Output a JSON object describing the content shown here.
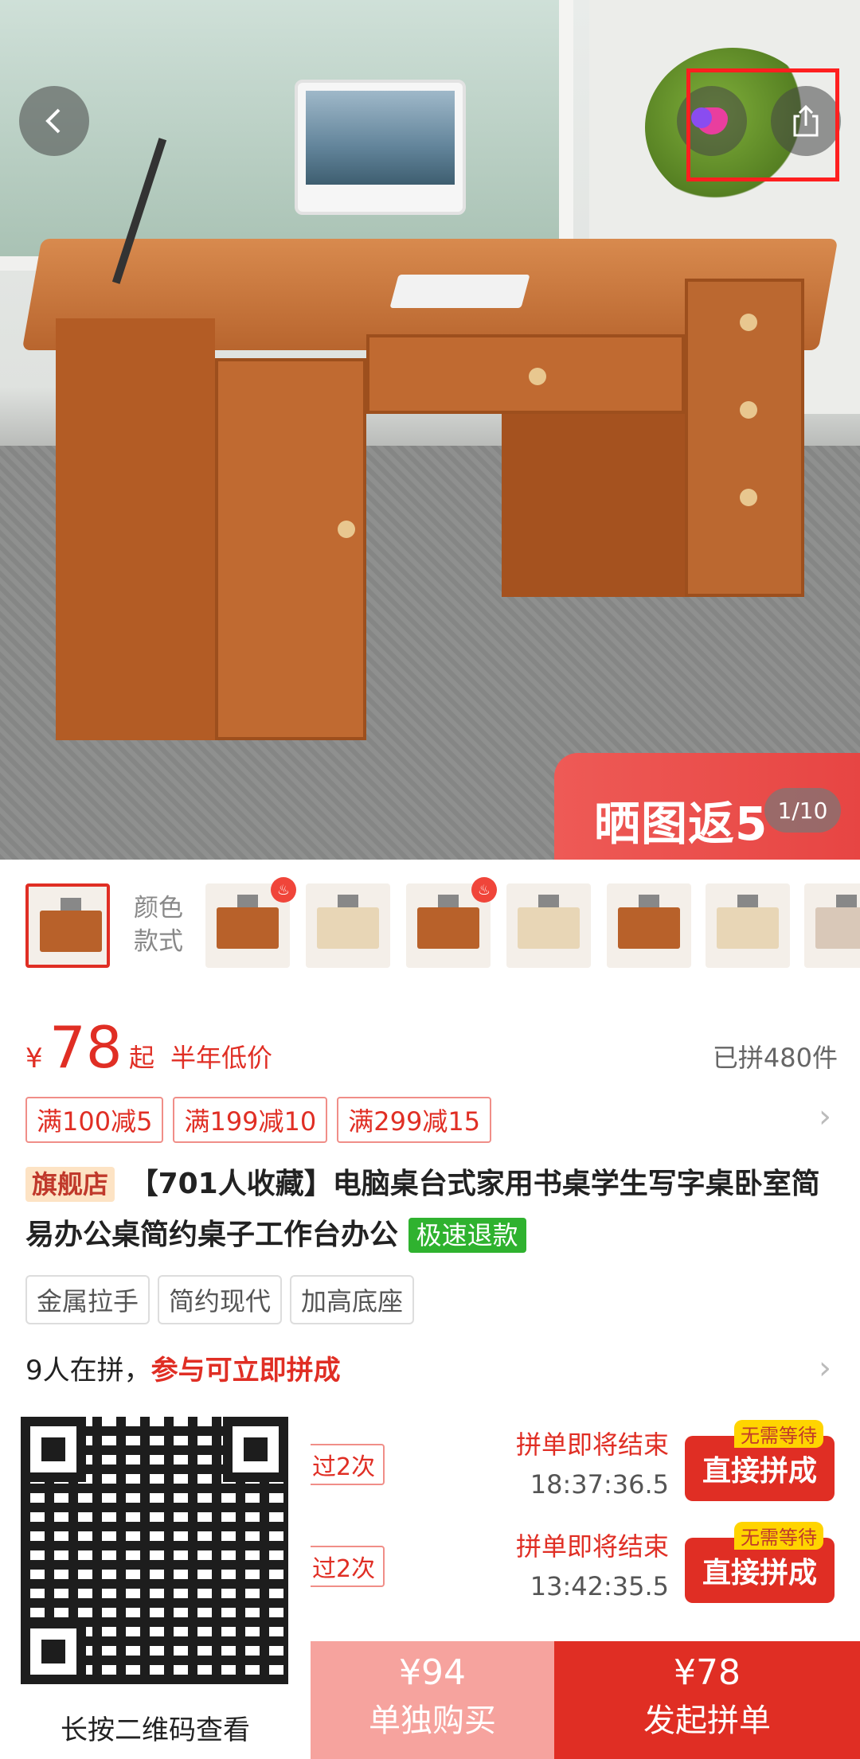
{
  "hero": {
    "promo_text": "晒图返5",
    "image_counter": "1/10"
  },
  "thumbs": {
    "label_line1": "颜色",
    "label_line2": "款式"
  },
  "price": {
    "currency": "¥",
    "value": "78",
    "suffix": "起",
    "low_label": "半年低价",
    "sold": "已拼480件"
  },
  "coupons": [
    "满100减5",
    "满199减10",
    "满299减15"
  ],
  "title": {
    "store_badge": "旗舰店",
    "text": "【701人收藏】电脑桌台式家用书桌学生写字桌卧室简易办公桌简约桌子工作台办公",
    "refund_badge": "极速退款"
  },
  "tags": [
    "金属拉手",
    "简约现代",
    "加高底座"
  ],
  "group": {
    "count_text": "9人在拼，",
    "join_text": "参与可立即拼成"
  },
  "group_rows": [
    {
      "pill": "过2次",
      "ends_label": "拼单即将结束",
      "time": "18:37:36.5",
      "button": "直接拼成",
      "badge": "无需等待"
    },
    {
      "pill": "过2次",
      "ends_label": "拼单即将结束",
      "time": "13:42:35.5",
      "button": "直接拼成",
      "badge": "无需等待"
    }
  ],
  "qr": {
    "caption": "长按二维码查看"
  },
  "bottom": {
    "solo_price": "¥94",
    "solo_label": "单独购买",
    "group_price": "¥78",
    "group_label": "发起拼单"
  },
  "colors": {
    "accent": "#e02e24",
    "refund_green": "#2fb22f"
  }
}
